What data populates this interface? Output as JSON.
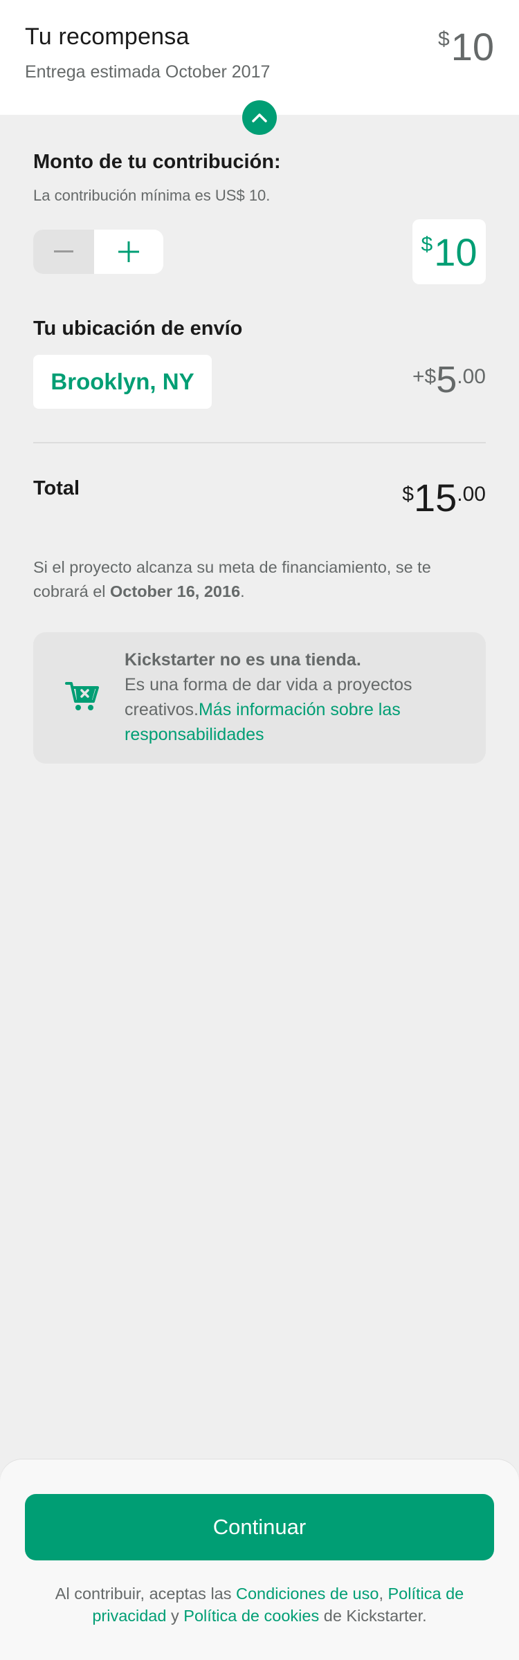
{
  "header": {
    "title": "Tu recompensa",
    "subtitle": "Entrega estimada October 2017",
    "reward_currency": "$",
    "reward_amount": "10"
  },
  "contribution": {
    "label": "Monto de tu contribución:",
    "minimum_note": "La contribución mínima es US$ 10.",
    "currency": "$",
    "amount": "10"
  },
  "shipping": {
    "label": "Tu ubicación de envío",
    "location": "Brooklyn, NY",
    "prefix": "+$",
    "amount_whole": "5",
    "amount_cents": ".00"
  },
  "total": {
    "label": "Total",
    "currency": "$",
    "amount_whole": "15",
    "amount_cents": ".00"
  },
  "charge_note": {
    "text_before": "Si el proyecto alcanza su meta de financiamiento, se te cobrará el ",
    "date": "October 16, 2016",
    "text_after": "."
  },
  "store_notice": {
    "title": "Kickstarter no es una tienda.",
    "body": "Es una forma de dar vida a proyectos creativos.",
    "link": "Más información sobre las responsabilidades"
  },
  "footer": {
    "continue_label": "Continuar",
    "terms_prefix": "Al contribuir, aceptas las ",
    "terms_link": "Condiciones de uso",
    "sep1": ", ",
    "privacy_link": "Política de privacidad",
    "sep2": " y ",
    "cookies_link": "Política de cookies",
    "terms_suffix": " de Kickstarter."
  },
  "icons": {
    "collapse": "chevron-up-icon",
    "decrement": "minus-icon",
    "increment": "plus-icon",
    "store": "cart-icon"
  },
  "colors": {
    "accent": "#009e74",
    "background": "#efefef",
    "text_secondary": "#656969"
  }
}
